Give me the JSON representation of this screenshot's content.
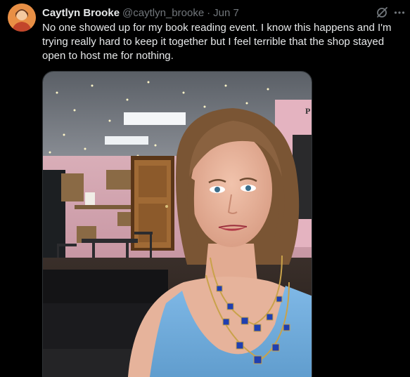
{
  "tweet": {
    "author": {
      "display_name": "Caytlyn Brooke",
      "handle": "@caytlyn_brooke",
      "avatar_icon": "avatar-icon"
    },
    "separator": "·",
    "date": "Jun 7",
    "text": "No one showed up for my book reading event. I know this happens and I'm trying really hard to keep it together but I feel terrible that the shop stayed open to host me for nothing.",
    "actions": {
      "grok_icon": "grok-icon",
      "more_icon": "more-icon"
    },
    "media": {
      "type": "photo",
      "shop_sign_fragment": "P"
    }
  },
  "colors": {
    "background": "#000000",
    "primary_text": "#e7e9ea",
    "secondary_text": "#71767b",
    "border": "#2f3336"
  }
}
